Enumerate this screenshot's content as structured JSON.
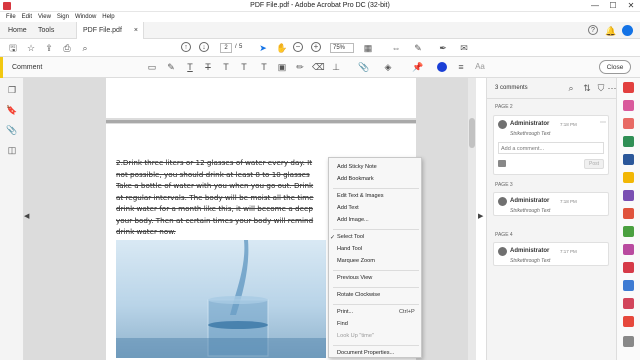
{
  "window": {
    "title": "PDF File.pdf - Adobe Acrobat Pro DC (32-bit)",
    "minimize": "—",
    "maximize": "☐",
    "close": "✕"
  },
  "menu": [
    "File",
    "Edit",
    "View",
    "Sign",
    "Window",
    "Help"
  ],
  "tabs": {
    "home": "Home",
    "tools": "Tools",
    "doc": "PDF File.pdf",
    "doc_close": "×"
  },
  "toolbar": {
    "page_current": "2",
    "page_sep": "/",
    "page_total": "5",
    "zoom": "75%"
  },
  "comment_bar": {
    "label": "Comment",
    "close": "Close",
    "color": "#1a3fd6"
  },
  "document": {
    "lines": [
      "2.Drink three liters or 12 glasses of water every day. It",
      "not possible, you should drink at least 8 to 10 glasses",
      "Take a bottle of water with you when you go out. Drink",
      "at regular intervals. The body will be moist all the time",
      "drink water for a month like this, it will become a deep",
      "your body. Then at certain times your body will remind",
      "drink water now."
    ]
  },
  "context_menu": {
    "items": [
      {
        "label": "Add Sticky Note",
        "disabled": false
      },
      {
        "label": "Add Bookmark",
        "disabled": false
      },
      {
        "label": "Edit Text & Images",
        "disabled": false
      },
      {
        "label": "Add Text",
        "disabled": false
      },
      {
        "label": "Add Image...",
        "disabled": false
      },
      {
        "label": "Select Tool",
        "disabled": false,
        "checked": true
      },
      {
        "label": "Hand Tool",
        "disabled": false
      },
      {
        "label": "Marquee Zoom",
        "disabled": false
      },
      {
        "label": "Previous View",
        "disabled": false
      },
      {
        "label": "Rotate Clockwise",
        "disabled": false
      },
      {
        "label": "Print...",
        "disabled": false,
        "shortcut": "Ctrl+P"
      },
      {
        "label": "Find",
        "disabled": false
      },
      {
        "label": "Look Up \"time\"",
        "disabled": true
      },
      {
        "label": "Document Properties...",
        "disabled": false
      }
    ],
    "check": "✓"
  },
  "comments_panel": {
    "count_label": "3 comments",
    "groups": [
      {
        "page": "PAGE 2",
        "author": "Administrator",
        "time": "7:18 PM",
        "type": "Strikethrough Text",
        "reply_placeholder": "Add a comment...",
        "post": "Post"
      },
      {
        "page": "PAGE 3",
        "author": "Administrator",
        "time": "7:18 PM",
        "type": "Strikethrough Text"
      },
      {
        "page": "PAGE 4",
        "author": "Administrator",
        "time": "7:17 PM",
        "type": "Strikethrough Text"
      }
    ]
  }
}
